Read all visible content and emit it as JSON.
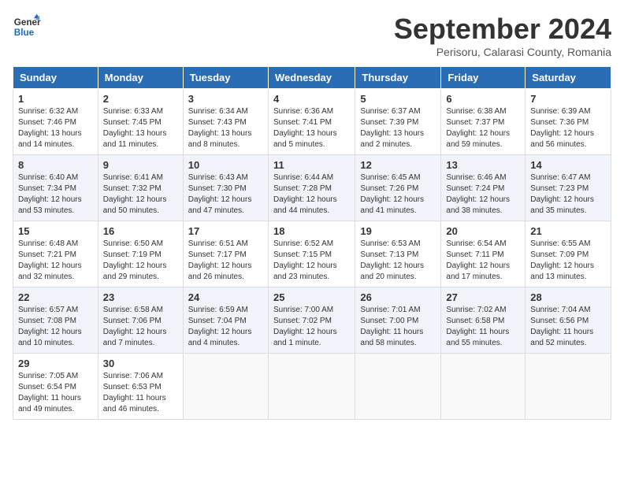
{
  "header": {
    "logo_line1": "General",
    "logo_line2": "Blue",
    "month_title": "September 2024",
    "location": "Perisoru, Calarasi County, Romania"
  },
  "weekdays": [
    "Sunday",
    "Monday",
    "Tuesday",
    "Wednesday",
    "Thursday",
    "Friday",
    "Saturday"
  ],
  "weeks": [
    [
      {
        "day": "1",
        "info": "Sunrise: 6:32 AM\nSunset: 7:46 PM\nDaylight: 13 hours\nand 14 minutes."
      },
      {
        "day": "2",
        "info": "Sunrise: 6:33 AM\nSunset: 7:45 PM\nDaylight: 13 hours\nand 11 minutes."
      },
      {
        "day": "3",
        "info": "Sunrise: 6:34 AM\nSunset: 7:43 PM\nDaylight: 13 hours\nand 8 minutes."
      },
      {
        "day": "4",
        "info": "Sunrise: 6:36 AM\nSunset: 7:41 PM\nDaylight: 13 hours\nand 5 minutes."
      },
      {
        "day": "5",
        "info": "Sunrise: 6:37 AM\nSunset: 7:39 PM\nDaylight: 13 hours\nand 2 minutes."
      },
      {
        "day": "6",
        "info": "Sunrise: 6:38 AM\nSunset: 7:37 PM\nDaylight: 12 hours\nand 59 minutes."
      },
      {
        "day": "7",
        "info": "Sunrise: 6:39 AM\nSunset: 7:36 PM\nDaylight: 12 hours\nand 56 minutes."
      }
    ],
    [
      {
        "day": "8",
        "info": "Sunrise: 6:40 AM\nSunset: 7:34 PM\nDaylight: 12 hours\nand 53 minutes."
      },
      {
        "day": "9",
        "info": "Sunrise: 6:41 AM\nSunset: 7:32 PM\nDaylight: 12 hours\nand 50 minutes."
      },
      {
        "day": "10",
        "info": "Sunrise: 6:43 AM\nSunset: 7:30 PM\nDaylight: 12 hours\nand 47 minutes."
      },
      {
        "day": "11",
        "info": "Sunrise: 6:44 AM\nSunset: 7:28 PM\nDaylight: 12 hours\nand 44 minutes."
      },
      {
        "day": "12",
        "info": "Sunrise: 6:45 AM\nSunset: 7:26 PM\nDaylight: 12 hours\nand 41 minutes."
      },
      {
        "day": "13",
        "info": "Sunrise: 6:46 AM\nSunset: 7:24 PM\nDaylight: 12 hours\nand 38 minutes."
      },
      {
        "day": "14",
        "info": "Sunrise: 6:47 AM\nSunset: 7:23 PM\nDaylight: 12 hours\nand 35 minutes."
      }
    ],
    [
      {
        "day": "15",
        "info": "Sunrise: 6:48 AM\nSunset: 7:21 PM\nDaylight: 12 hours\nand 32 minutes."
      },
      {
        "day": "16",
        "info": "Sunrise: 6:50 AM\nSunset: 7:19 PM\nDaylight: 12 hours\nand 29 minutes."
      },
      {
        "day": "17",
        "info": "Sunrise: 6:51 AM\nSunset: 7:17 PM\nDaylight: 12 hours\nand 26 minutes."
      },
      {
        "day": "18",
        "info": "Sunrise: 6:52 AM\nSunset: 7:15 PM\nDaylight: 12 hours\nand 23 minutes."
      },
      {
        "day": "19",
        "info": "Sunrise: 6:53 AM\nSunset: 7:13 PM\nDaylight: 12 hours\nand 20 minutes."
      },
      {
        "day": "20",
        "info": "Sunrise: 6:54 AM\nSunset: 7:11 PM\nDaylight: 12 hours\nand 17 minutes."
      },
      {
        "day": "21",
        "info": "Sunrise: 6:55 AM\nSunset: 7:09 PM\nDaylight: 12 hours\nand 13 minutes."
      }
    ],
    [
      {
        "day": "22",
        "info": "Sunrise: 6:57 AM\nSunset: 7:08 PM\nDaylight: 12 hours\nand 10 minutes."
      },
      {
        "day": "23",
        "info": "Sunrise: 6:58 AM\nSunset: 7:06 PM\nDaylight: 12 hours\nand 7 minutes."
      },
      {
        "day": "24",
        "info": "Sunrise: 6:59 AM\nSunset: 7:04 PM\nDaylight: 12 hours\nand 4 minutes."
      },
      {
        "day": "25",
        "info": "Sunrise: 7:00 AM\nSunset: 7:02 PM\nDaylight: 12 hours\nand 1 minute."
      },
      {
        "day": "26",
        "info": "Sunrise: 7:01 AM\nSunset: 7:00 PM\nDaylight: 11 hours\nand 58 minutes."
      },
      {
        "day": "27",
        "info": "Sunrise: 7:02 AM\nSunset: 6:58 PM\nDaylight: 11 hours\nand 55 minutes."
      },
      {
        "day": "28",
        "info": "Sunrise: 7:04 AM\nSunset: 6:56 PM\nDaylight: 11 hours\nand 52 minutes."
      }
    ],
    [
      {
        "day": "29",
        "info": "Sunrise: 7:05 AM\nSunset: 6:54 PM\nDaylight: 11 hours\nand 49 minutes."
      },
      {
        "day": "30",
        "info": "Sunrise: 7:06 AM\nSunset: 6:53 PM\nDaylight: 11 hours\nand 46 minutes."
      },
      {
        "day": "",
        "info": ""
      },
      {
        "day": "",
        "info": ""
      },
      {
        "day": "",
        "info": ""
      },
      {
        "day": "",
        "info": ""
      },
      {
        "day": "",
        "info": ""
      }
    ]
  ]
}
